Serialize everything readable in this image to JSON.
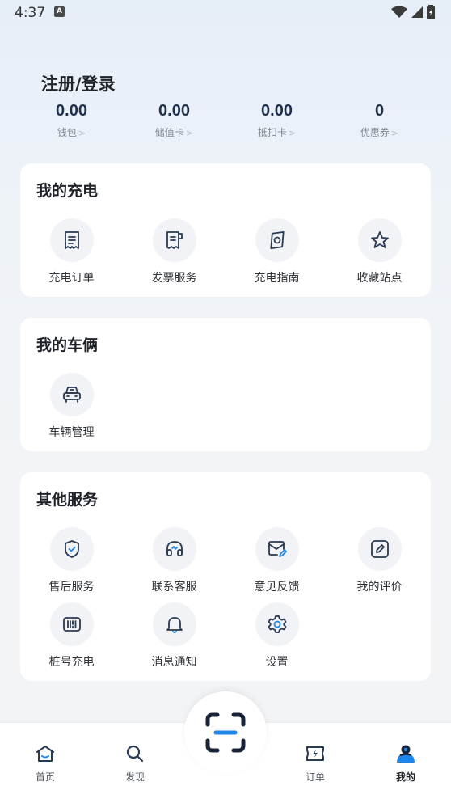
{
  "status_bar": {
    "time": "4:37",
    "notification_badge": "A"
  },
  "header": {
    "login_text": "注册/登录"
  },
  "stats": [
    {
      "value": "0.00",
      "label": "钱包"
    },
    {
      "value": "0.00",
      "label": "储值卡"
    },
    {
      "value": "0.00",
      "label": "抵扣卡"
    },
    {
      "value": "0",
      "label": "优惠券"
    }
  ],
  "sections": {
    "charging": {
      "title": "我的充电",
      "items": [
        {
          "label": "充电订单",
          "icon": "receipt-icon"
        },
        {
          "label": "发票服务",
          "icon": "invoice-icon"
        },
        {
          "label": "充电指南",
          "icon": "guide-icon"
        },
        {
          "label": "收藏站点",
          "icon": "star-icon"
        }
      ]
    },
    "vehicle": {
      "title": "我的车俩",
      "items": [
        {
          "label": "车辆管理",
          "icon": "car-icon"
        }
      ]
    },
    "services": {
      "title": "其他服务",
      "items": [
        {
          "label": "售后服务",
          "icon": "shield-check-icon"
        },
        {
          "label": "联系客服",
          "icon": "headset-icon"
        },
        {
          "label": "意见反馈",
          "icon": "feedback-mail-icon"
        },
        {
          "label": "我的评价",
          "icon": "edit-icon"
        },
        {
          "label": "桩号充电",
          "icon": "barcode-icon"
        },
        {
          "label": "消息通知",
          "icon": "bell-icon"
        },
        {
          "label": "设置",
          "icon": "gear-icon"
        }
      ]
    }
  },
  "tabbar": {
    "items": [
      {
        "label": "首页",
        "icon": "home-icon"
      },
      {
        "label": "发现",
        "icon": "search-icon"
      },
      {
        "label": "订单",
        "icon": "order-icon"
      },
      {
        "label": "我的",
        "icon": "profile-icon",
        "active": true
      }
    ],
    "scan_icon": "scan-icon"
  },
  "colors": {
    "accent": "#1e86e8",
    "primary_text": "#1f2329",
    "icon_stroke": "#2a3a52"
  }
}
